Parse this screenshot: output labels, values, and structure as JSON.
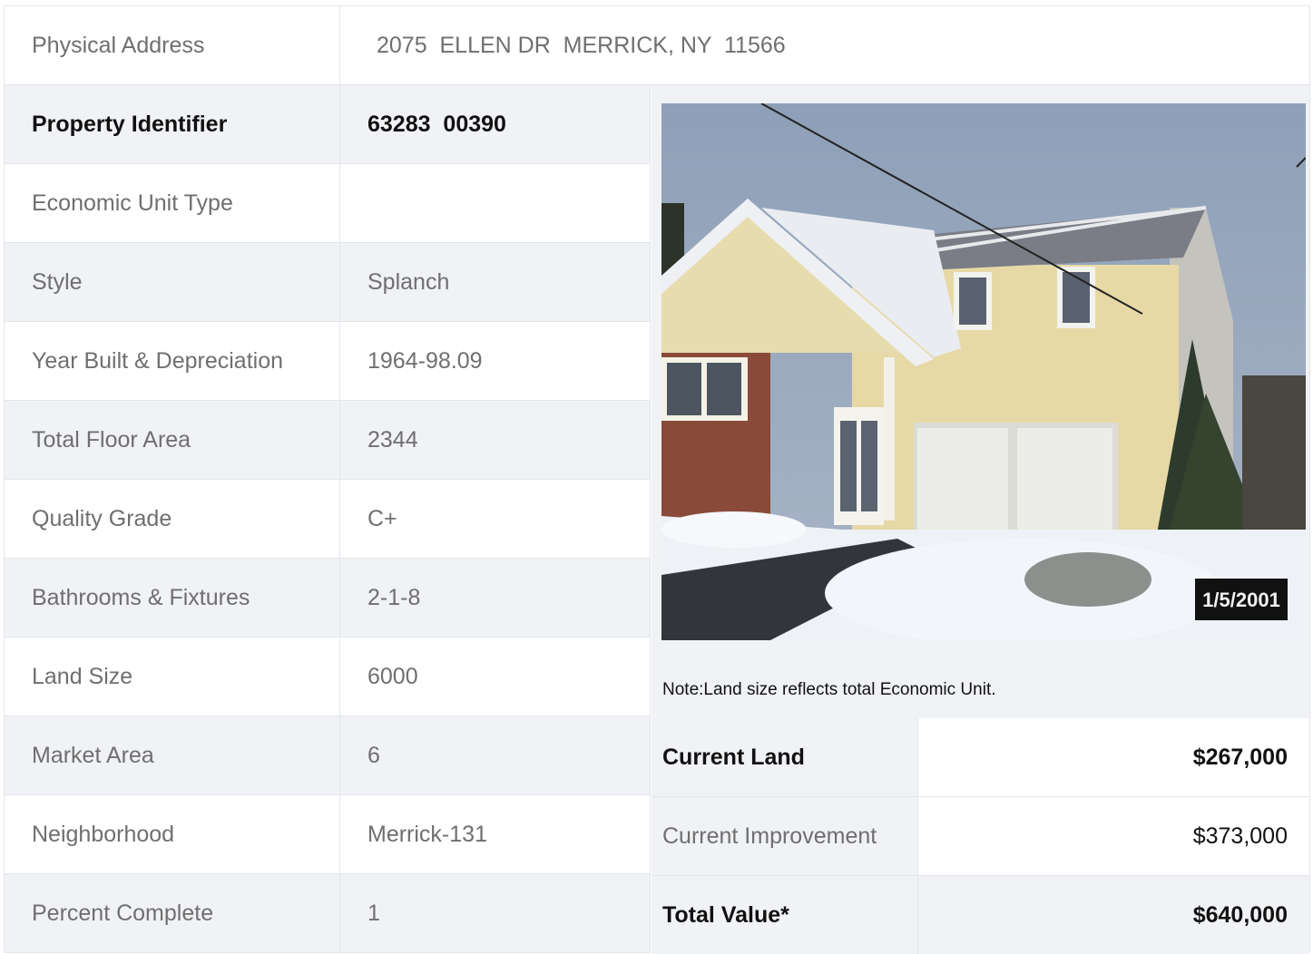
{
  "address": {
    "label": "Physical Address",
    "value": "2075  ELLEN DR  MERRICK, NY  11566"
  },
  "property": {
    "rows": [
      {
        "label": "Property Identifier",
        "value": "63283  00390"
      },
      {
        "label": "Economic Unit Type",
        "value": ""
      },
      {
        "label": "Style",
        "value": "Splanch"
      },
      {
        "label": "Year Built & Depreciation",
        "value": "1964-98.09"
      },
      {
        "label": "Total Floor Area",
        "value": "2344"
      },
      {
        "label": "Quality Grade",
        "value": "C+"
      },
      {
        "label": "Bathrooms & Fixtures",
        "value": "2-1-8"
      },
      {
        "label": "Land Size",
        "value": "6000"
      },
      {
        "label": "Market Area",
        "value": "6"
      },
      {
        "label": "Neighborhood",
        "value": "Merrick-131"
      },
      {
        "label": "Percent Complete",
        "value": "1"
      }
    ]
  },
  "photo": {
    "date_stamp": "1/5/2001",
    "subject": "house-photo"
  },
  "note": "Note:Land size reflects total Economic Unit.",
  "values": {
    "rows": [
      {
        "label": "Current Land",
        "value": "$267,000"
      },
      {
        "label": "Current Improvement",
        "value": "$373,000"
      },
      {
        "label": "Total Value*",
        "value": "$640,000"
      }
    ]
  },
  "colors": {
    "shaded_row": "#f0f2f5",
    "border": "#e3e6ea",
    "label_text": "#6f6f6f",
    "bold_text": "#111111"
  }
}
